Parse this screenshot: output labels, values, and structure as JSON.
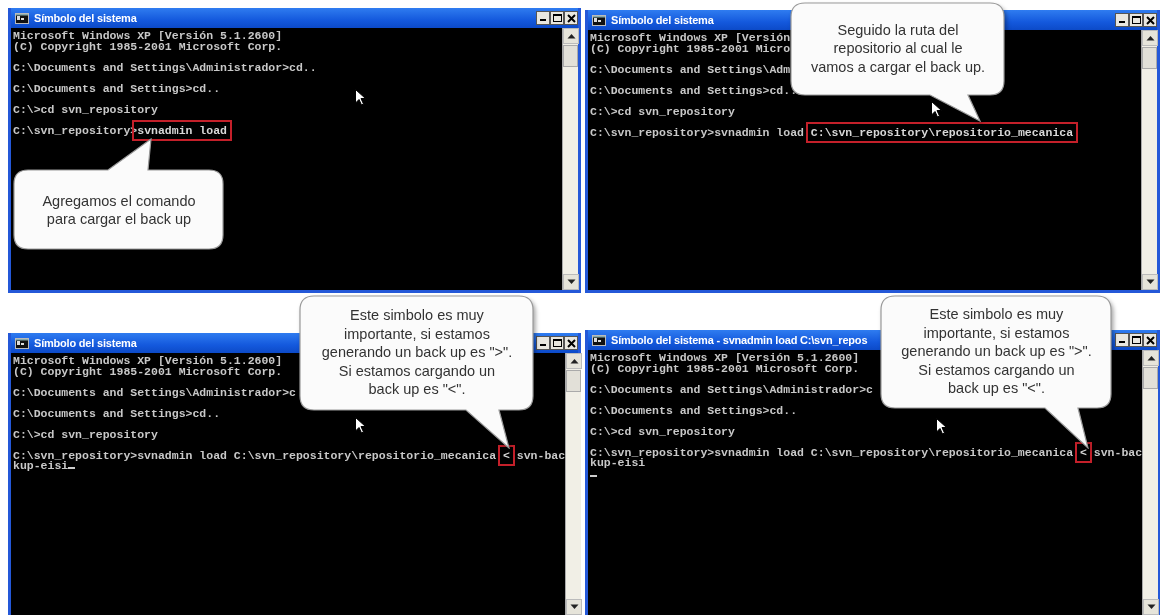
{
  "windows": [
    {
      "title": "Símbolo del sistema",
      "callout": {
        "text": "Agregamos el comando\npara cargar el back up"
      },
      "lines": [
        {
          "kind": "text",
          "cursor": false,
          "segments": [
            {
              "text": "Microsoft Windows XP [Versión 5.1.2600]",
              "highlighted": false
            }
          ]
        },
        {
          "kind": "text",
          "cursor": false,
          "segments": [
            {
              "text": "(C) Copyright 1985-2001 Microsoft Corp.",
              "highlighted": false
            }
          ]
        },
        {
          "kind": "blank"
        },
        {
          "kind": "text",
          "cursor": false,
          "segments": [
            {
              "text": "C:\\Documents and Settings\\Administrador>cd..",
              "highlighted": false
            }
          ]
        },
        {
          "kind": "blank"
        },
        {
          "kind": "text",
          "cursor": false,
          "segments": [
            {
              "text": "C:\\Documents and Settings>cd..",
              "highlighted": false
            }
          ]
        },
        {
          "kind": "blank"
        },
        {
          "kind": "text",
          "cursor": false,
          "segments": [
            {
              "text": "C:\\>cd svn_repository",
              "highlighted": false
            }
          ]
        },
        {
          "kind": "blank"
        },
        {
          "kind": "text",
          "cursor": false,
          "segments": [
            {
              "text": "C:\\svn_repository>",
              "highlighted": false
            },
            {
              "text": "svnadmin load",
              "highlighted": true
            }
          ]
        }
      ]
    },
    {
      "title": "Símbolo del sistema",
      "callout": {
        "text": "Seguido la ruta del\nrepositorio al cual le\nvamos a cargar el back up."
      },
      "lines": [
        {
          "kind": "text",
          "cursor": false,
          "segments": [
            {
              "text": "Microsoft Windows XP [Versión",
              "highlighted": false
            }
          ]
        },
        {
          "kind": "text",
          "cursor": false,
          "segments": [
            {
              "text": "(C) Copyright 1985-2001 Micro",
              "highlighted": false
            }
          ]
        },
        {
          "kind": "blank"
        },
        {
          "kind": "text",
          "cursor": false,
          "segments": [
            {
              "text": "C:\\Documents and Settings\\Adm",
              "highlighted": false
            }
          ]
        },
        {
          "kind": "blank"
        },
        {
          "kind": "text",
          "cursor": false,
          "segments": [
            {
              "text": "C:\\Documents and Settings>cd..",
              "highlighted": false
            }
          ]
        },
        {
          "kind": "blank"
        },
        {
          "kind": "text",
          "cursor": false,
          "segments": [
            {
              "text": "C:\\>cd svn_repository",
              "highlighted": false
            }
          ]
        },
        {
          "kind": "blank"
        },
        {
          "kind": "text",
          "cursor": false,
          "segments": [
            {
              "text": "C:\\svn_repository>svnadmin load ",
              "highlighted": false
            },
            {
              "text": "C:\\svn_repository\\repositorio_mecanica",
              "highlighted": true
            }
          ]
        }
      ]
    },
    {
      "title": "Símbolo del sistema",
      "callout": {
        "text": "Este simbolo es muy\nimportante, si estamos\ngenerando un back up es \">\".\nSi estamos cargando un\nback up es \"<\"."
      },
      "lines": [
        {
          "kind": "text",
          "cursor": false,
          "segments": [
            {
              "text": "Microsoft Windows XP [Versión 5.1.2600]",
              "highlighted": false
            }
          ]
        },
        {
          "kind": "text",
          "cursor": false,
          "segments": [
            {
              "text": "(C) Copyright 1985-2001 Microsoft Corp.",
              "highlighted": false
            }
          ]
        },
        {
          "kind": "blank"
        },
        {
          "kind": "text",
          "cursor": false,
          "segments": [
            {
              "text": "C:\\Documents and Settings\\Administrador>c",
              "highlighted": false
            }
          ]
        },
        {
          "kind": "blank"
        },
        {
          "kind": "text",
          "cursor": false,
          "segments": [
            {
              "text": "C:\\Documents and Settings>cd..",
              "highlighted": false
            }
          ]
        },
        {
          "kind": "blank"
        },
        {
          "kind": "text",
          "cursor": false,
          "segments": [
            {
              "text": "C:\\>cd svn_repository",
              "highlighted": false
            }
          ]
        },
        {
          "kind": "blank"
        },
        {
          "kind": "text",
          "cursor": false,
          "segments": [
            {
              "text": "C:\\svn_repository>svnadmin load C:\\svn_repository\\repositorio_mecanica ",
              "highlighted": false
            },
            {
              "text": "<",
              "highlighted": true
            },
            {
              "text": " svn-bac",
              "highlighted": false
            }
          ]
        },
        {
          "kind": "text",
          "cursor": true,
          "segments": [
            {
              "text": "kup-eisi",
              "highlighted": false
            }
          ]
        }
      ]
    },
    {
      "title": "Símbolo del sistema - svnadmin load C:\\svn_repos",
      "callout": {
        "text": "Este simbolo es muy\nimportante, si estamos\ngenerando un back up es \">\".\nSi estamos cargando un\nback up es \"<\"."
      },
      "lines": [
        {
          "kind": "text",
          "cursor": false,
          "segments": [
            {
              "text": "Microsoft Windows XP [Versión 5.1.2600]",
              "highlighted": false
            }
          ]
        },
        {
          "kind": "text",
          "cursor": false,
          "segments": [
            {
              "text": "(C) Copyright 1985-2001 Microsoft Corp.",
              "highlighted": false
            }
          ]
        },
        {
          "kind": "blank"
        },
        {
          "kind": "text",
          "cursor": false,
          "segments": [
            {
              "text": "C:\\Documents and Settings\\Administrador>c",
              "highlighted": false
            }
          ]
        },
        {
          "kind": "blank"
        },
        {
          "kind": "text",
          "cursor": false,
          "segments": [
            {
              "text": "C:\\Documents and Settings>cd..",
              "highlighted": false
            }
          ]
        },
        {
          "kind": "blank"
        },
        {
          "kind": "text",
          "cursor": false,
          "segments": [
            {
              "text": "C:\\>cd svn_repository",
              "highlighted": false
            }
          ]
        },
        {
          "kind": "blank"
        },
        {
          "kind": "text",
          "cursor": false,
          "segments": [
            {
              "text": "C:\\svn_repository>svnadmin load C:\\svn_repository\\repositorio_mecanica ",
              "highlighted": false
            },
            {
              "text": "<",
              "highlighted": true
            },
            {
              "text": " svn-bac",
              "highlighted": false
            }
          ]
        },
        {
          "kind": "text",
          "cursor": false,
          "segments": [
            {
              "text": "kup-eisi",
              "highlighted": false
            }
          ]
        },
        {
          "kind": "text",
          "cursor": true
        }
      ]
    }
  ]
}
